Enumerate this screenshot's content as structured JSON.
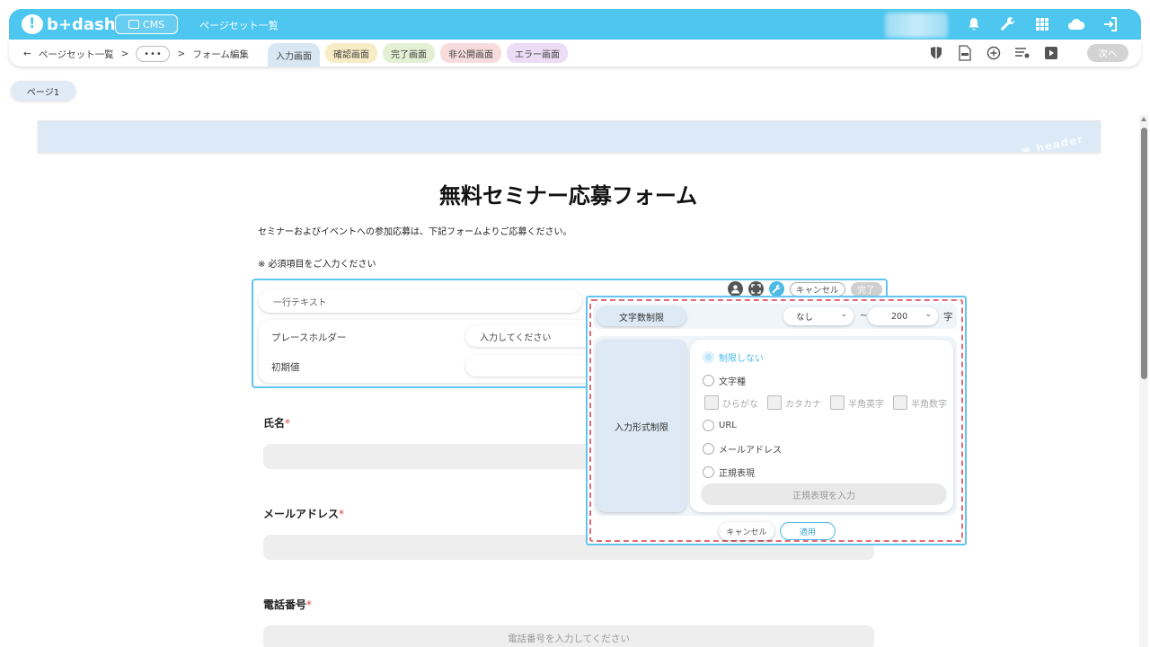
{
  "app": {
    "logo_text": "b+dash",
    "cms_label": "CMS",
    "topbar_title": "ページセット一覧"
  },
  "top_icons": [
    "bell-icon",
    "wrench-icon",
    "grid-icon",
    "cloud-icon",
    "logout-icon"
  ],
  "breadcrumb": {
    "back": "←",
    "item1": "ページセット一覧",
    "sep1": ">",
    "more": "•••",
    "sep2": ">",
    "item2": "フォーム編集"
  },
  "tabs": [
    {
      "label": "入力画面"
    },
    {
      "label": "確認画面"
    },
    {
      "label": "完了画面"
    },
    {
      "label": "非公開画面"
    },
    {
      "label": "エラー画面"
    }
  ],
  "sub_icons": [
    "shield-icon",
    "html-file-icon",
    "plus-circle-icon",
    "list-settings-icon",
    "play-icon"
  ],
  "next_button": "次へ",
  "page_tab": "ページ1",
  "header_band": {
    "text": "header"
  },
  "form": {
    "title": "無料セミナー応募フォーム",
    "description": "セミナーおよびイベントへの参加応募は、下記フォームよりご応募ください。",
    "note": "※ 必須項目をご入力ください",
    "field_type": "一行テキスト",
    "placeholder_label": "プレースホルダー",
    "placeholder_value": "入力してください",
    "initial_label": "初期値",
    "initial_value": "",
    "tools_cancel": "キャンセル",
    "tools_done": "完了",
    "required_mark": "*",
    "fields": [
      {
        "label": "氏名",
        "placeholder": ""
      },
      {
        "label": "メールアドレス",
        "placeholder": ""
      },
      {
        "label": "電話番号",
        "placeholder": "電話番号を入力してください"
      }
    ]
  },
  "popup": {
    "char_limit_label": "文字数制限",
    "min_value": "なし",
    "tilde": "~",
    "max_value": "200",
    "unit": "字",
    "input_type_label": "入力形式制限",
    "options": {
      "unlimited": "制限しない",
      "char_type": "文字種",
      "hiragana": "ひらがな",
      "katakana": "カタカナ",
      "half_alpha": "半角英字",
      "half_num": "半角数字",
      "url": "URL",
      "email": "メールアドレス",
      "regex": "正規表現"
    },
    "regex_placeholder": "正規表現を入力",
    "cancel": "キャンセル",
    "apply": "適用"
  }
}
